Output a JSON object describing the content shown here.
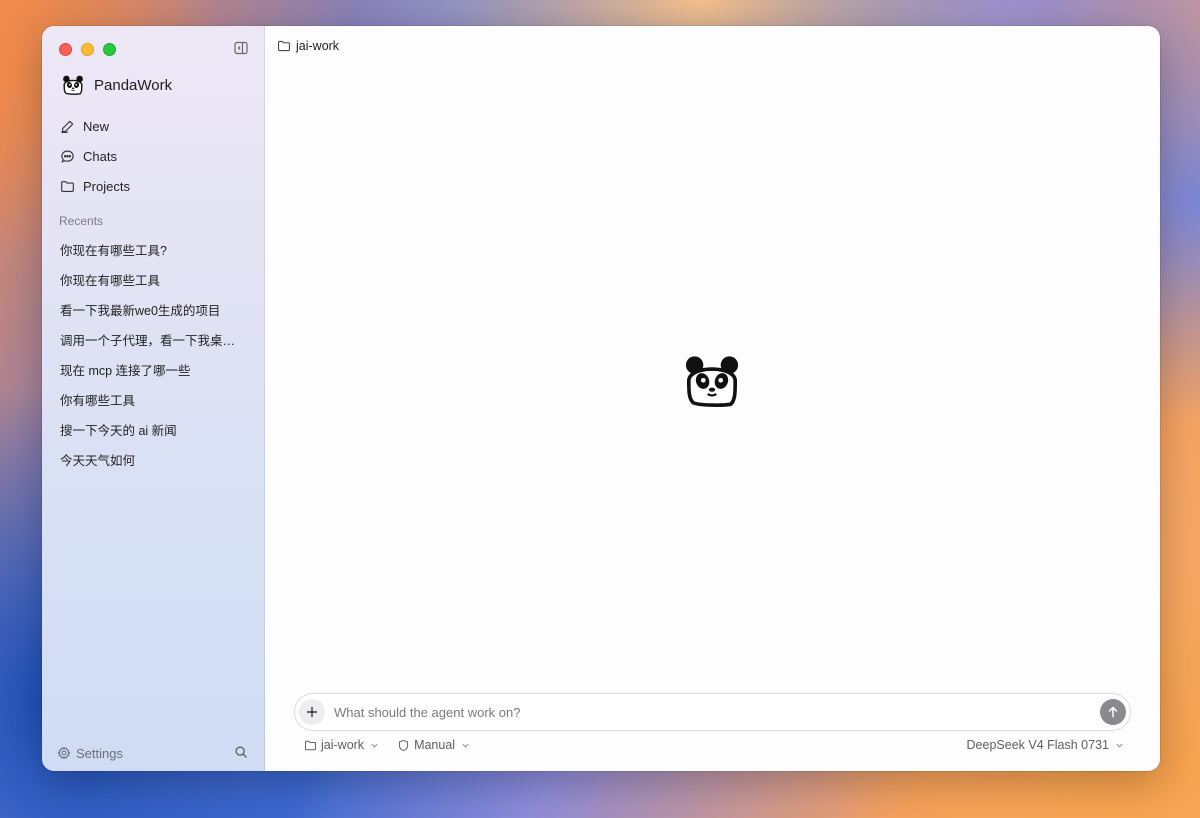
{
  "sidebar": {
    "brand": "PandaWork",
    "nav": [
      {
        "label": "New",
        "icon": "pen-icon"
      },
      {
        "label": "Chats",
        "icon": "chat-bubble-icon"
      },
      {
        "label": "Projects",
        "icon": "folder-icon"
      }
    ],
    "recents_title": "Recents",
    "recents": [
      "你现在有哪些工具?",
      "你现在有哪些工具",
      "看一下我最新we0生成的项目",
      "调用一个子代理，看一下我桌…",
      "现在 mcp 连接了哪一些",
      "你有哪些工具",
      "搜一下今天的 ai 新闻",
      "今天天气如何"
    ],
    "settings_label": "Settings"
  },
  "main": {
    "breadcrumb": "jai-work",
    "composer": {
      "placeholder": "What should the agent work on?",
      "value": "",
      "workspace": "jai-work",
      "mode": "Manual",
      "model": "DeepSeek V4 Flash 0731"
    }
  },
  "colors": {
    "close": "#fe5f57",
    "minimize": "#febc2e",
    "maximize": "#28c840",
    "send_button": "#8a8a8e"
  }
}
